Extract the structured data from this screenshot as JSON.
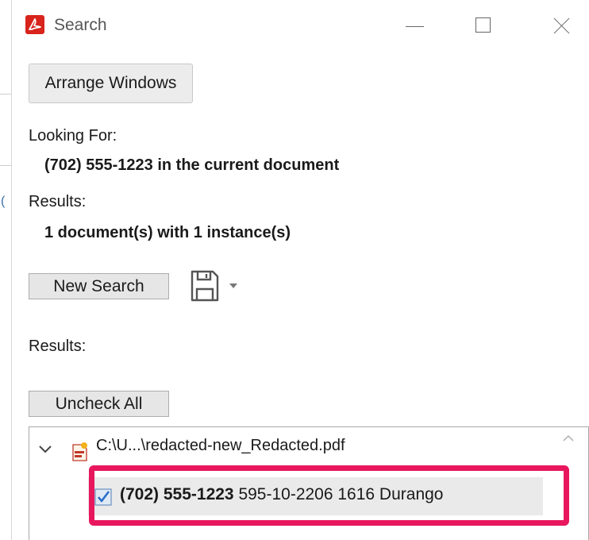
{
  "window": {
    "title": "Search",
    "app_icon": "acrobat-icon"
  },
  "toolbar": {
    "arrange_label": "Arrange Windows"
  },
  "search": {
    "looking_for_label": "Looking For:",
    "looking_for_value": "(702) 555-1223 in the current document",
    "results_label": "Results:",
    "results_value": "1 document(s) with 1 instance(s)"
  },
  "actions": {
    "new_search_label": "New Search",
    "save_icon": "save-icon",
    "results_label": "Results:",
    "uncheck_all_label": "Uncheck All"
  },
  "results": {
    "file": {
      "name": "C:\\U...\\redacted-new_Redacted.pdf",
      "icon": "pdf-redacted-icon",
      "expanded": true
    },
    "instances": [
      {
        "match": "(702) 555-1223",
        "context": " 595-10-2206 1616 Durango",
        "checked": true
      }
    ]
  },
  "colors": {
    "highlight": "#e8175d",
    "acrobat_red": "#d8241c"
  }
}
